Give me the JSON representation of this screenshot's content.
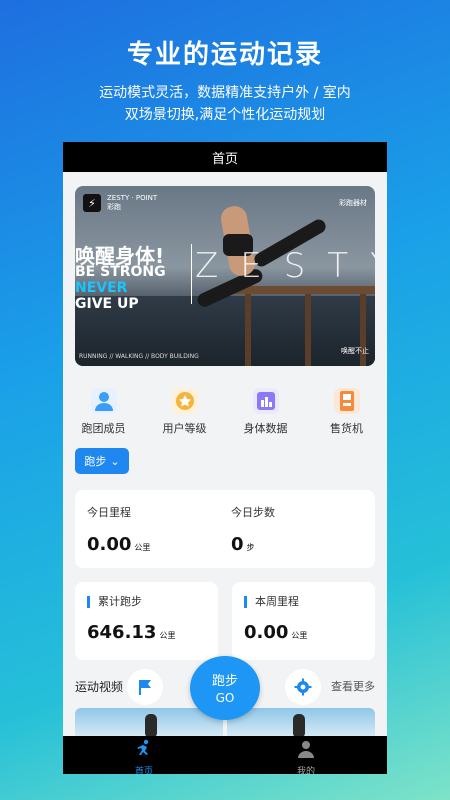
{
  "promo": {
    "title": "专业的运动记录",
    "subtitle_line1": "运动模式灵活，数据精准支持户外 / 室内",
    "subtitle_line2": "双场景切换,满足个性化运动规划"
  },
  "app": {
    "header_title": "首页",
    "banner": {
      "brand_line1": "ZESTY · POINT",
      "brand_line2": "彩跑",
      "right_top": "彩跑器材",
      "slogan_cn": "唤醒身体!",
      "slogan_1": "BE STRONG",
      "slogan_2": "NEVER",
      "slogan_3": "GIVE UP",
      "zesty": "ZESTY",
      "footer": "RUNNING // WALKING // BODY BUILDING",
      "right_bottom": "唤醒不止"
    },
    "quick_actions": [
      {
        "label": "跑团成员",
        "icon": "team-members-icon",
        "color": "#3a9df5"
      },
      {
        "label": "用户等级",
        "icon": "user-level-icon",
        "color": "#f5b53a"
      },
      {
        "label": "身体数据",
        "icon": "body-data-icon",
        "color": "#8a7af5"
      },
      {
        "label": "售货机",
        "icon": "vending-machine-icon",
        "color": "#f58a3a"
      }
    ],
    "sport_select": {
      "label": "跑步",
      "arrow": "⌄"
    },
    "today": {
      "distance_label": "今日里程",
      "distance_value": "0.00",
      "distance_unit": "公里",
      "steps_label": "今日步数",
      "steps_value": "0",
      "steps_unit": "步"
    },
    "total_run": {
      "label": "累计跑步",
      "value": "646.13",
      "unit": "公里"
    },
    "week_distance": {
      "label": "本周里程",
      "value": "0.00",
      "unit": "公里"
    },
    "video_section": {
      "title": "运动视频",
      "more": "查看更多"
    },
    "fab": {
      "line1": "跑步",
      "line2": "GO"
    },
    "tabs": [
      {
        "label": "首页",
        "icon": "runner-icon"
      },
      {
        "label": "我的",
        "icon": "person-icon"
      }
    ],
    "accent_color": "#1e96f5"
  }
}
